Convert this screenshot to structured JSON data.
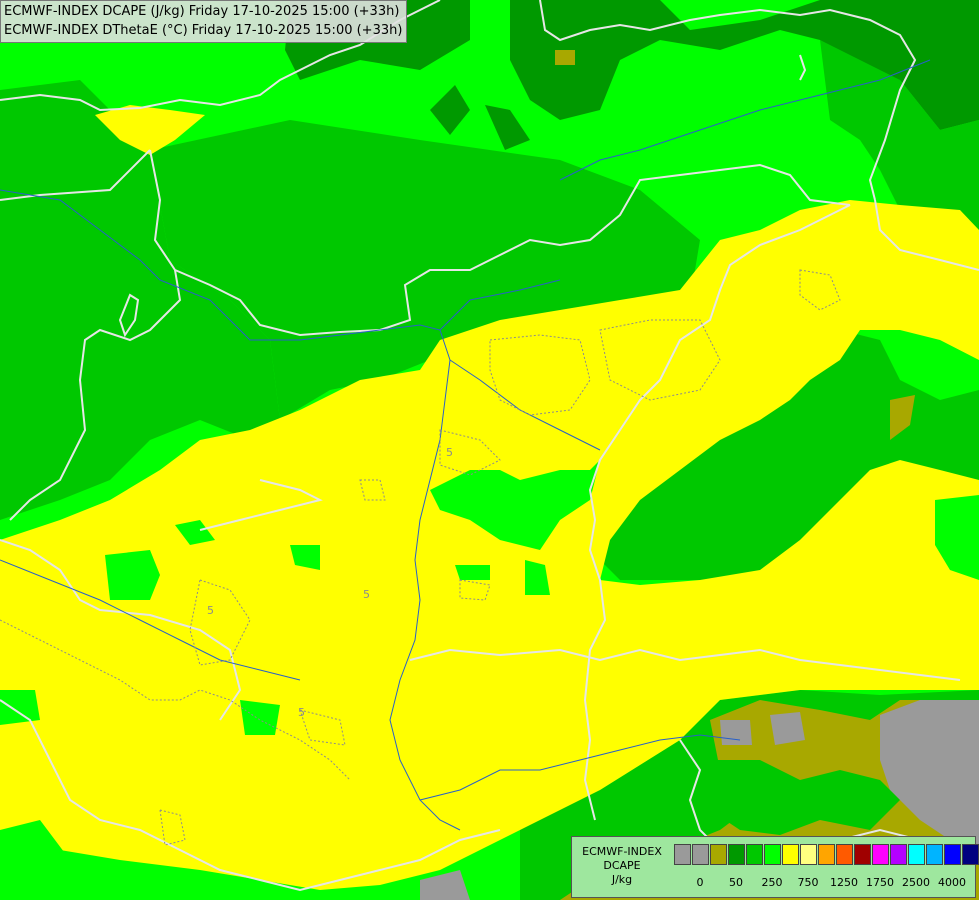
{
  "header": {
    "line1": "ECMWF-INDEX DCAPE (J/kg) Friday 17-10-2025 15:00 (+33h)",
    "line2": "ECMWF-INDEX DThetaE (°C) Friday 17-10-2025 15:00 (+33h)"
  },
  "contour_labels": [
    "5",
    "5",
    "5",
    "5"
  ],
  "legend": {
    "title": "ECMWF-INDEX",
    "variable": "DCAPE",
    "unit": "J/kg",
    "colors": [
      "#9a9a9a",
      "#9a9a9a",
      "#a8a800",
      "#009900",
      "#00c800",
      "#00ff00",
      "#ffff00",
      "#ffff80",
      "#ffa500",
      "#ff5a00",
      "#a00000",
      "#ff00ff",
      "#b400ff",
      "#00ffff",
      "#00b4ff",
      "#0000ff",
      "#000080"
    ],
    "tick_labels": [
      "0",
      "50",
      "250",
      "750",
      "1250",
      "1750",
      "2500",
      "4000"
    ]
  },
  "colors": {
    "bright_green": "#00ff00",
    "mid_green": "#00c800",
    "dark_green": "#009900",
    "yellow": "#ffff00",
    "olive": "#a8a800",
    "gray": "#9a9a9a"
  }
}
